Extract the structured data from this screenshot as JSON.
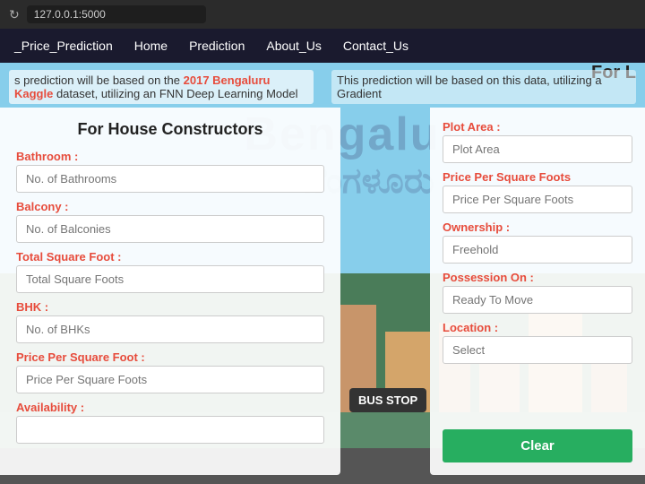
{
  "browser": {
    "url": "127.0.0.1:5000",
    "reload_icon": "↻"
  },
  "navbar": {
    "brand": "_Price_Prediction",
    "links": [
      "Home",
      "Prediction",
      "About_Us",
      "Contact_Us"
    ]
  },
  "hero": {
    "prediction_left": "s prediction will be based on the ",
    "highlight": "2017 Bengaluru Kaggle",
    "prediction_left_end": " dataset, utilizing an FNN Deep Learning Model",
    "prediction_right": "This prediction will be based on this data, utilizing a Gradient",
    "watermark_en": "Bengaluru",
    "watermark_kn": "ಬೆಂಗಳೂರು",
    "bus_stop": "BUS STOP",
    "for_l": "For L"
  },
  "panel_left": {
    "title": "For House Constructors",
    "fields": [
      {
        "label": "Bathroom :",
        "placeholder": "No. of Bathrooms",
        "name": "bathroom-input"
      },
      {
        "label": "Balcony :",
        "placeholder": "No. of Balconies",
        "name": "balcony-input"
      },
      {
        "label": "Total Square Foot :",
        "placeholder": "Total Square Foots",
        "name": "total-sqft-input"
      },
      {
        "label": "BHK :",
        "placeholder": "No. of BHKs",
        "name": "bhk-input"
      },
      {
        "label": "Price Per Square Foot :",
        "placeholder": "Price Per Square Foots",
        "name": "price-sqft-input"
      },
      {
        "label": "Availability :",
        "placeholder": "",
        "name": "availability-input"
      }
    ]
  },
  "panel_right": {
    "fields": [
      {
        "label": "Plot Area :",
        "placeholder": "Plot Area",
        "name": "plot-area-input"
      },
      {
        "label": "Price Per Square Foots",
        "placeholder": "Price Per Square Foots",
        "name": "price-sqft-right-input"
      },
      {
        "label": "Ownership :",
        "placeholder": "Freehold",
        "name": "ownership-input"
      },
      {
        "label": "Possession On :",
        "placeholder": "Ready To Move",
        "name": "possession-input"
      },
      {
        "label": "Location :",
        "placeholder": "Select",
        "name": "location-input"
      }
    ],
    "clear_button": "Clear"
  }
}
